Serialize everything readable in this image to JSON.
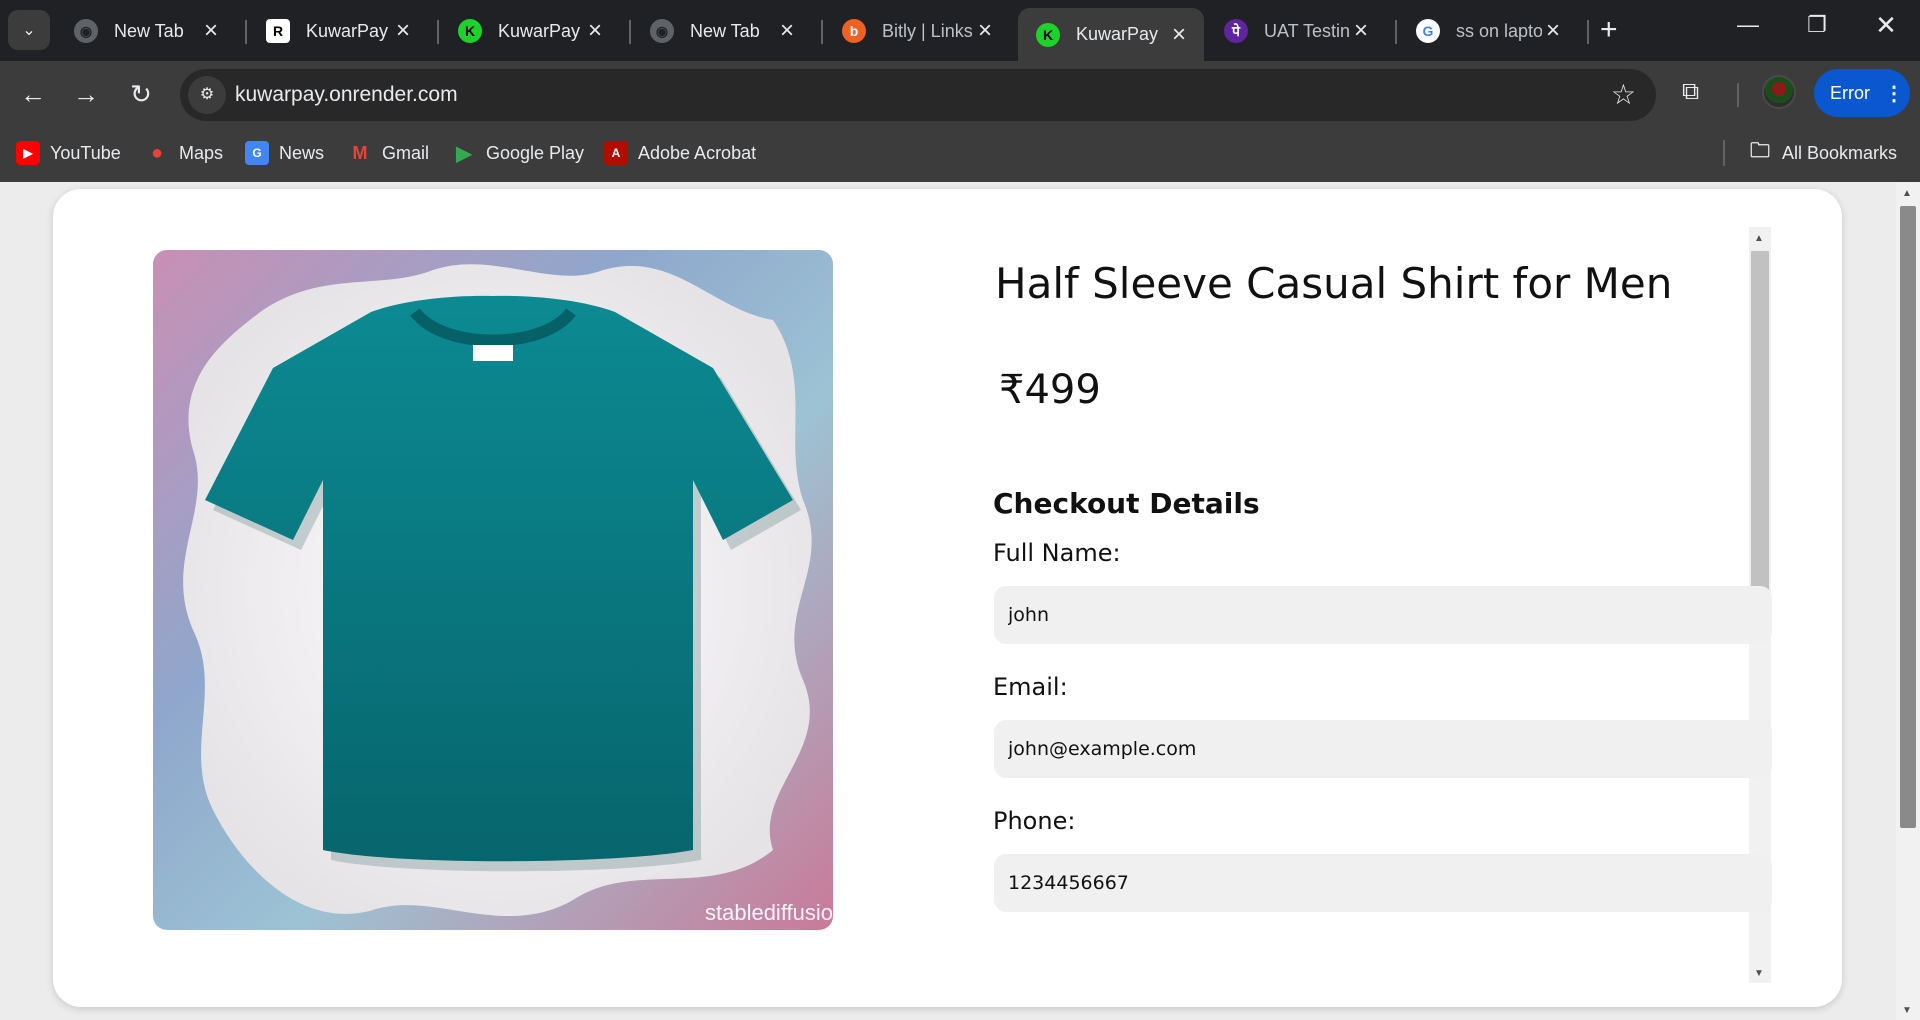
{
  "browser": {
    "tabs": [
      {
        "title": "New Tab",
        "icon": "chrome-icon"
      },
      {
        "title": "KuwarPay",
        "icon": "render-icon"
      },
      {
        "title": "KuwarPay",
        "icon": "kuwarpay-icon"
      },
      {
        "title": "New Tab",
        "icon": "chrome-icon"
      },
      {
        "title": "Bitly | Links",
        "icon": "bitly-icon"
      },
      {
        "title": "KuwarPay",
        "icon": "kuwarpay-icon",
        "active": true
      },
      {
        "title": "UAT Testing",
        "icon": "phonepe-icon"
      },
      {
        "title": "ss on laptop",
        "icon": "google-icon"
      }
    ],
    "url": "kuwarpay.onrender.com",
    "profile_status": "Error",
    "bookmarks": [
      {
        "label": "YouTube",
        "icon": "youtube-icon"
      },
      {
        "label": "Maps",
        "icon": "maps-icon"
      },
      {
        "label": "News",
        "icon": "news-icon"
      },
      {
        "label": "Gmail",
        "icon": "gmail-icon"
      },
      {
        "label": "Google Play",
        "icon": "play-icon"
      },
      {
        "label": "Adobe Acrobat",
        "icon": "acrobat-icon"
      }
    ],
    "all_bookmarks": "All Bookmarks"
  },
  "product": {
    "title": "Half Sleeve Casual Shirt for Men",
    "price": "₹499",
    "image_watermark": "stablediffusio",
    "image_icon": "teal-tshirt-image"
  },
  "checkout": {
    "heading": "Checkout Details",
    "fields": [
      {
        "label": "Full Name:",
        "value": "john"
      },
      {
        "label": "Email:",
        "value": "john@example.com"
      },
      {
        "label": "Phone:",
        "value": "1234456667"
      }
    ]
  },
  "colors": {
    "browser_frame": "#202124",
    "toolbar": "#3c3c3c",
    "accent_blue": "#0b57d0",
    "shirt_teal": "#0b7e86",
    "input_bg": "#f0f0f0"
  }
}
